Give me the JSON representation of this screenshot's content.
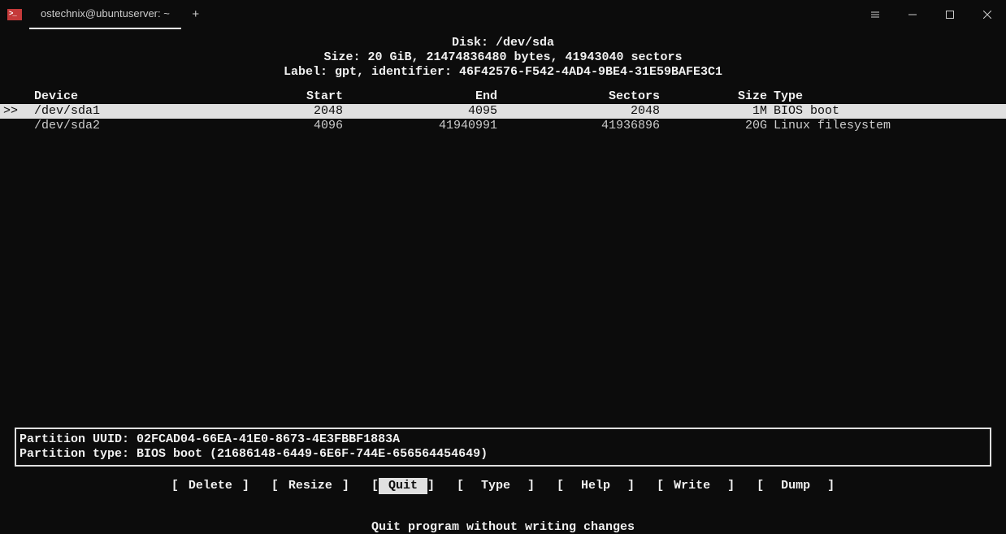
{
  "window": {
    "tab_title": "ostechnix@ubuntuserver: ~",
    "new_tab_label": "+"
  },
  "disk": {
    "title_prefix": "Disk: ",
    "path": "/dev/sda",
    "size_line": "Size: 20 GiB, 21474836480 bytes, 41943040 sectors",
    "label_line": "Label: gpt, identifier: 46F42576-F542-4AD4-9BE4-31E59BAFE3C1"
  },
  "columns": {
    "device": "Device",
    "start": "Start",
    "end": "End",
    "sectors": "Sectors",
    "size": "Size",
    "type": "Type"
  },
  "partitions": [
    {
      "marker": ">>",
      "device": "/dev/sda1",
      "start": "2048",
      "end": "4095",
      "sectors": "2048",
      "size": "1M",
      "type": "BIOS boot",
      "selected": true
    },
    {
      "marker": "",
      "device": "/dev/sda2",
      "start": "4096",
      "end": "41940991",
      "sectors": "41936896",
      "size": "20G",
      "type": "Linux filesystem",
      "selected": false
    }
  ],
  "info": {
    "uuid_line": "Partition UUID: 02FCAD04-66EA-41E0-8673-4E3FBBF1883A",
    "type_line": "Partition type: BIOS boot (21686148-6449-6E6F-744E-656564454649)"
  },
  "menu": {
    "items": [
      {
        "label": "Delete",
        "selected": false
      },
      {
        "label": "Resize",
        "selected": false
      },
      {
        "label": " Quit ",
        "selected": true
      },
      {
        "label": " Type ",
        "selected": false
      },
      {
        "label": " Help ",
        "selected": false
      },
      {
        "label": "Write ",
        "selected": false
      },
      {
        "label": " Dump ",
        "selected": false
      }
    ]
  },
  "hint": "Quit program without writing changes"
}
